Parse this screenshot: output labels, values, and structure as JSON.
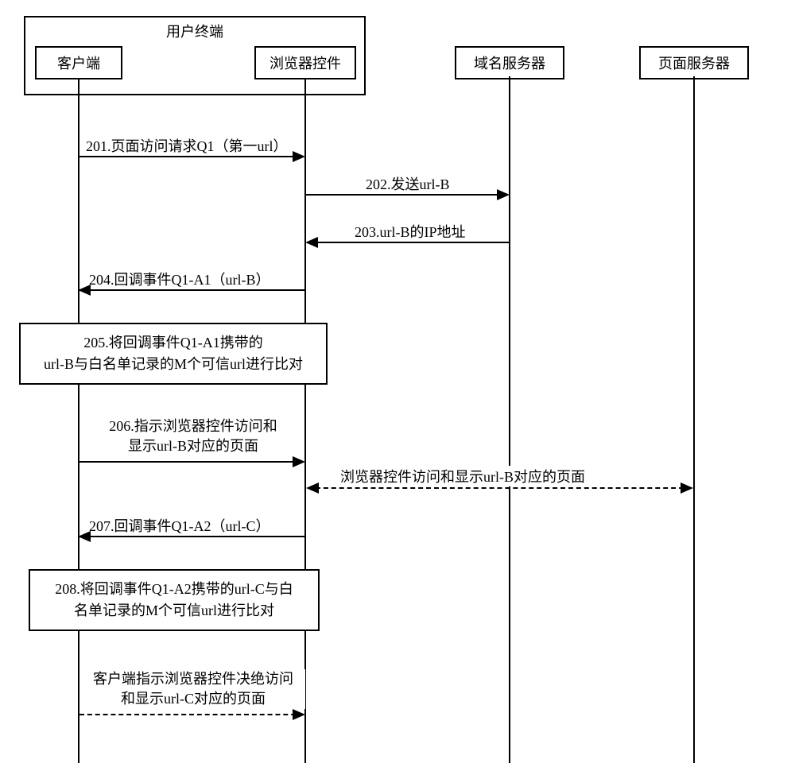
{
  "participants": {
    "user_terminal": "用户终端",
    "client": "客户端",
    "browser_control": "浏览器控件",
    "dns_server": "域名服务器",
    "page_server": "页面服务器"
  },
  "messages": {
    "m201": "201.页面访问请求Q1（第一url）",
    "m202": "202.发送url-B",
    "m203": "203.url-B的IP地址",
    "m204": "204.回调事件Q1-A1（url-B）",
    "m205_l1": "205.将回调事件Q1-A1携带的",
    "m205_l2": "url-B与白名单记录的M个可信url进行比对",
    "m206_l1": "206.指示浏览器控件访问和",
    "m206_l2": "显示url-B对应的页面",
    "m206_r": "浏览器控件访问和显示url-B对应的页面",
    "m207": "207.回调事件Q1-A2（url-C）",
    "m208_l1": "208.将回调事件Q1-A2携带的url-C与白",
    "m208_l2": "名单记录的M个可信url进行比对",
    "m_end_l1": "客户端指示浏览器控件决绝访问",
    "m_end_l2": "和显示url-C对应的页面"
  },
  "chart_data": {
    "type": "sequence-diagram",
    "participants": [
      {
        "id": "client",
        "label": "客户端",
        "parent": "用户终端"
      },
      {
        "id": "browser_control",
        "label": "浏览器控件",
        "parent": "用户终端"
      },
      {
        "id": "dns_server",
        "label": "域名服务器"
      },
      {
        "id": "page_server",
        "label": "页面服务器"
      }
    ],
    "steps": [
      {
        "n": 201,
        "from": "client",
        "to": "browser_control",
        "text": "页面访问请求Q1（第一url）",
        "style": "solid"
      },
      {
        "n": 202,
        "from": "browser_control",
        "to": "dns_server",
        "text": "发送url-B",
        "style": "solid"
      },
      {
        "n": 203,
        "from": "dns_server",
        "to": "browser_control",
        "text": "url-B的IP地址",
        "style": "solid"
      },
      {
        "n": 204,
        "from": "browser_control",
        "to": "client",
        "text": "回调事件Q1-A1（url-B）",
        "style": "solid"
      },
      {
        "n": 205,
        "at": "client",
        "type": "process",
        "text": "将回调事件Q1-A1携带的url-B与白名单记录的M个可信url进行比对"
      },
      {
        "n": 206,
        "from": "client",
        "to": "browser_control",
        "text": "指示浏览器控件访问和显示url-B对应的页面",
        "style": "solid"
      },
      {
        "from": "browser_control",
        "to": "page_server",
        "text": "浏览器控件访问和显示url-B对应的页面",
        "style": "dashed",
        "bidirectional": true
      },
      {
        "n": 207,
        "from": "browser_control",
        "to": "client",
        "text": "回调事件Q1-A2（url-C）",
        "style": "solid"
      },
      {
        "n": 208,
        "at": "client",
        "type": "process",
        "text": "将回调事件Q1-A2携带的url-C与白名单记录的M个可信url进行比对"
      },
      {
        "from": "client",
        "to": "browser_control",
        "text": "客户端指示浏览器控件决绝访问和显示url-C对应的页面",
        "style": "dashed"
      }
    ]
  }
}
